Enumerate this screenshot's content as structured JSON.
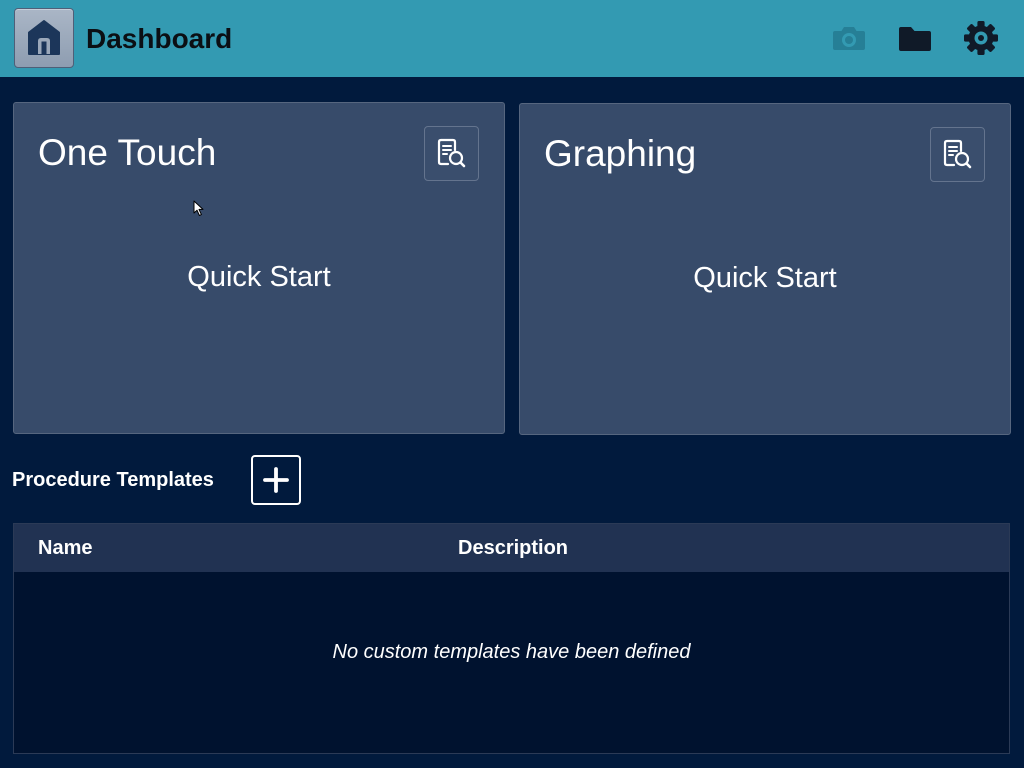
{
  "header": {
    "title": "Dashboard",
    "home_icon": "home-icon",
    "actions": [
      {
        "icon": "camera-icon",
        "disabled": true
      },
      {
        "icon": "folder-icon",
        "disabled": false
      },
      {
        "icon": "gear-icon",
        "disabled": false
      }
    ]
  },
  "cards": [
    {
      "title": "One Touch",
      "action_label": "Quick Start",
      "icon": "document-search-icon"
    },
    {
      "title": "Graphing",
      "action_label": "Quick Start",
      "icon": "document-search-icon"
    }
  ],
  "templates": {
    "section_title": "Procedure Templates",
    "add_icon": "plus-icon",
    "columns": [
      "Name",
      "Description"
    ],
    "rows": [],
    "empty_message": "No custom templates have been defined"
  },
  "colors": {
    "header_bg": "#339ab2",
    "page_bg": "#011a3d",
    "card_bg": "#374b6a",
    "card_border": "#56667f",
    "table_header_bg": "#213252",
    "table_body_bg": "#00122f",
    "icon_dark": "#101a28",
    "camera_disabled": "#267f96",
    "home_icon": "#1c365a",
    "text_light": "#ffffff",
    "title_dark": "#0b0f14"
  }
}
